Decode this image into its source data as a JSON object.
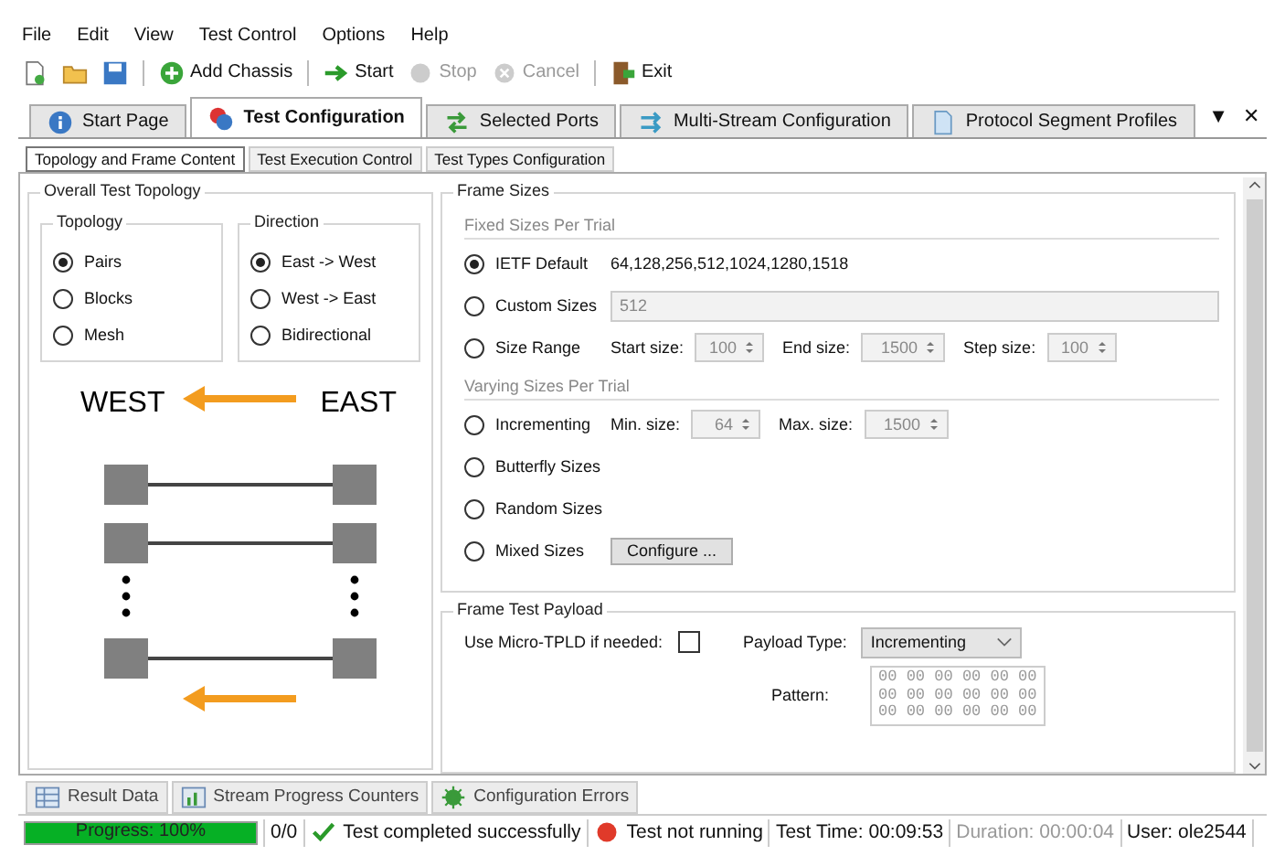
{
  "menu": [
    "File",
    "Edit",
    "View",
    "Test Control",
    "Options",
    "Help"
  ],
  "toolbar": [
    {
      "kind": "icon"
    },
    {
      "kind": "icon"
    },
    {
      "kind": "icon"
    },
    {
      "kind": "sep"
    },
    {
      "kind": "button",
      "label": "Add Chassis",
      "disabled": false
    },
    {
      "kind": "sep"
    },
    {
      "kind": "button",
      "label": "Start",
      "disabled": false
    },
    {
      "kind": "button",
      "label": "Stop",
      "disabled": true
    },
    {
      "kind": "button",
      "label": "Cancel",
      "disabled": true
    },
    {
      "kind": "sep"
    },
    {
      "kind": "button",
      "label": "Exit",
      "disabled": false
    }
  ],
  "doc_tabs": [
    {
      "label": "Start Page",
      "selected": false
    },
    {
      "label": "Test Configuration",
      "selected": true
    },
    {
      "label": "Selected Ports",
      "selected": false
    },
    {
      "label": "Multi-Stream Configuration",
      "selected": false
    },
    {
      "label": "Protocol Segment Profiles",
      "selected": false
    }
  ],
  "doc_tab_controls": [
    "▼",
    "✕"
  ],
  "sub_tabs": [
    {
      "label": "Topology and Frame Content",
      "selected": true
    },
    {
      "label": "Test Execution Control",
      "selected": false
    },
    {
      "label": "Test Types Configuration",
      "selected": false
    }
  ],
  "topology": {
    "title": "Overall Test Topology",
    "groups": [
      {
        "title": "Topology",
        "options": [
          {
            "label": "Pairs",
            "selected": true
          },
          {
            "label": "Blocks",
            "selected": false
          },
          {
            "label": "Mesh",
            "selected": false
          }
        ]
      },
      {
        "title": "Direction",
        "options": [
          {
            "label": "East -> West",
            "selected": true
          },
          {
            "label": "West -> East",
            "selected": false
          },
          {
            "label": "Bidirectional",
            "selected": false
          }
        ]
      }
    ],
    "diagram": {
      "left_label": "WEST",
      "right_label": "EAST"
    }
  },
  "frame_sizes": {
    "title": "Frame Sizes",
    "sections": [
      {
        "title": "Fixed Sizes Per Trial",
        "rows": [
          {
            "kind": "text",
            "label": "IETF Default",
            "selected": true,
            "value": "64,128,256,512,1024,1280,1518"
          },
          {
            "kind": "field",
            "label": "Custom Sizes",
            "selected": false,
            "value": "512",
            "disabled": true
          },
          {
            "kind": "spinners",
            "label": "Size Range",
            "selected": false,
            "spinners": [
              {
                "label": "Start size:",
                "value": "100",
                "disabled": true
              },
              {
                "label": "End size:",
                "value": "1500",
                "disabled": true
              },
              {
                "label": "Step size:",
                "value": "100",
                "disabled": true
              }
            ]
          }
        ]
      },
      {
        "title": "Varying Sizes Per Trial",
        "rows": [
          {
            "kind": "spinners",
            "label": "Incrementing",
            "selected": false,
            "spinners": [
              {
                "label": "Min. size:",
                "value": "64",
                "disabled": true
              },
              {
                "label": "Max. size:",
                "value": "1500",
                "disabled": true
              }
            ]
          },
          {
            "kind": "plain",
            "label": "Butterfly Sizes",
            "selected": false
          },
          {
            "kind": "plain",
            "label": "Random Sizes",
            "selected": false
          },
          {
            "kind": "button",
            "label": "Mixed Sizes",
            "selected": false,
            "button": "Configure ..."
          }
        ]
      }
    ]
  },
  "payload": {
    "title": "Frame Test Payload",
    "micro_label": "Use Micro-TPLD if needed:",
    "micro_checked": false,
    "type_label": "Payload Type:",
    "type_value": "Incrementing",
    "pattern_label": "Pattern:",
    "pattern_disabled": true,
    "pattern_rows": [
      "00 00 00 00 00 00",
      "00 00 00 00 00 00",
      "00 00 00 00 00 00"
    ]
  },
  "bottom_tabs": [
    {
      "label": "Result Data",
      "selected": false
    },
    {
      "label": "Stream Progress Counters",
      "selected": false
    },
    {
      "label": "Configuration Errors",
      "selected": false
    }
  ],
  "status_bar": {
    "progress": {
      "label": "Progress: 100%",
      "level": 1
    },
    "count": "0/0",
    "result": "Test completed successfully",
    "state": "Test not running",
    "test_time": "Test Time: 00:09:53",
    "duration": "Duration: 00:00:04",
    "duration_disabled": true,
    "user": "User: ole2544"
  }
}
